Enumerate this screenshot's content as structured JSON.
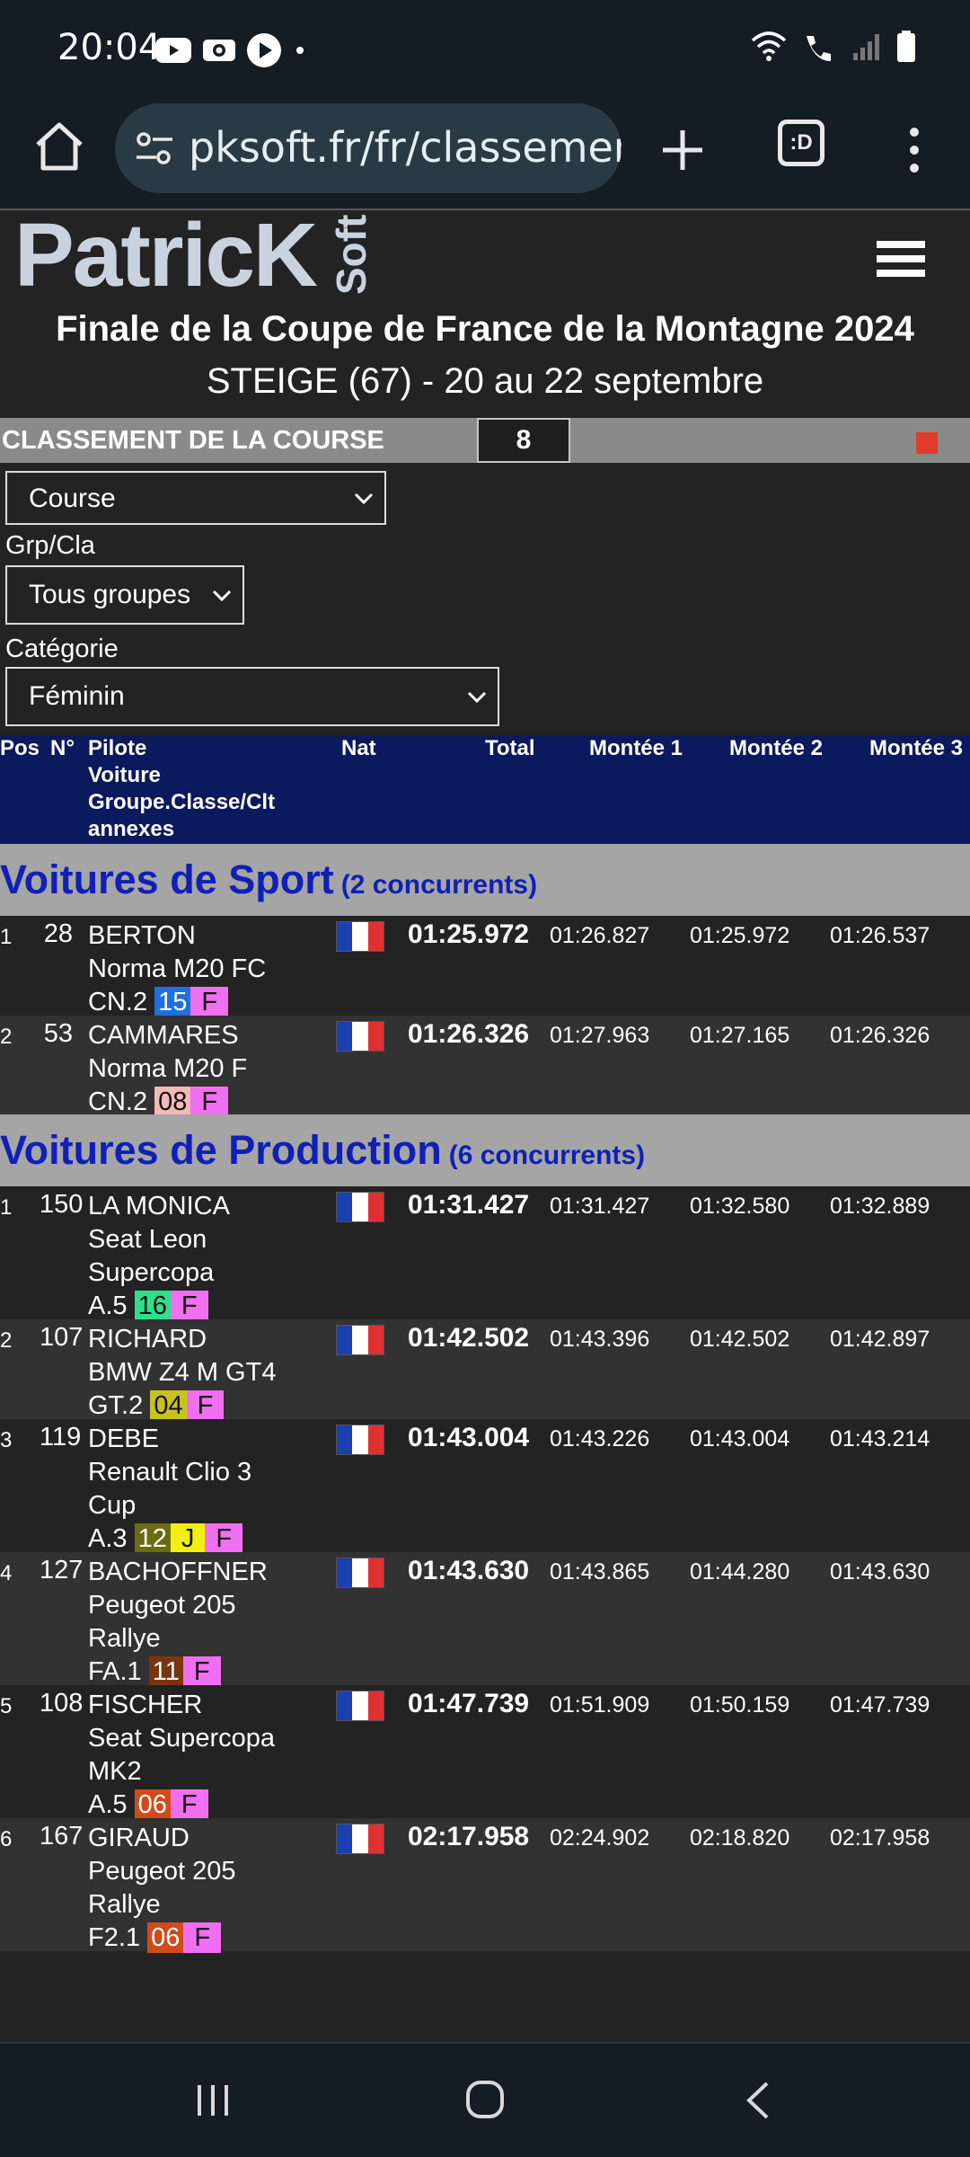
{
  "status": {
    "time": "20:04"
  },
  "browser": {
    "url": "pksoft.fr/fr/classement",
    "tab_count": ":D"
  },
  "site": {
    "logo_main": "PatricK",
    "logo_soft": "Soft",
    "event_title": "Finale de la Coupe de France de la Montagne 2024",
    "event_subtitle": "STEIGE (67) - 20 au 22 septembre"
  },
  "classement": {
    "label": "CLASSEMENT DE LA COURSE",
    "number": "8"
  },
  "filters": {
    "course_value": "Course",
    "grp_label": "Grp/Cla",
    "grp_value": "Tous groupes",
    "cat_label": "Catégorie",
    "cat_value": "Féminin"
  },
  "table_header": {
    "pos": "Pos",
    "num": "N°",
    "pilote_lines": [
      "Pilote",
      "Voiture",
      "Groupe.Classe/Clt",
      "annexes"
    ],
    "nat": "Nat",
    "total": "Total",
    "m1": "Montée 1",
    "m2": "Montée 2",
    "m3": "Montée 3"
  },
  "groups": [
    {
      "title": "Voitures de Sport",
      "count": "(2 concurrents)",
      "rows": [
        {
          "pos": "1",
          "num": "28",
          "pilote": "BERTON",
          "car": [
            "Norma M20 FC"
          ],
          "cls": "CN.2",
          "badges": [
            {
              "t": "15",
              "bg": "#1f6fe0",
              "fg": "#ffffff"
            },
            {
              "t": "F",
              "bg": "#f06ff0",
              "fg": "#111111"
            }
          ],
          "total": "01:25.972",
          "m1": "01:26.827",
          "m2": "01:25.972",
          "m3": "01:26.537"
        },
        {
          "pos": "2",
          "num": "53",
          "pilote": "CAMMARES",
          "car": [
            "Norma M20 F"
          ],
          "cls": "CN.2",
          "badges": [
            {
              "t": "08",
              "bg": "#f4b8b8",
              "fg": "#111111"
            },
            {
              "t": "F",
              "bg": "#f06ff0",
              "fg": "#111111"
            }
          ],
          "total": "01:26.326",
          "m1": "01:27.963",
          "m2": "01:27.165",
          "m3": "01:26.326"
        }
      ]
    },
    {
      "title": "Voitures de Production",
      "count": "(6 concurrents)",
      "rows": [
        {
          "pos": "1",
          "num": "150",
          "pilote": "LA MONICA",
          "car": [
            "Seat Leon",
            "Supercopa"
          ],
          "cls": "A.5",
          "badges": [
            {
              "t": "16",
              "bg": "#2ee08a",
              "fg": "#111111"
            },
            {
              "t": "F",
              "bg": "#f06ff0",
              "fg": "#111111"
            }
          ],
          "total": "01:31.427",
          "m1": "01:31.427",
          "m2": "01:32.580",
          "m3": "01:32.889"
        },
        {
          "pos": "2",
          "num": "107",
          "pilote": "RICHARD",
          "car": [
            "BMW Z4 M GT4"
          ],
          "cls": "GT.2",
          "badges": [
            {
              "t": "04",
              "bg": "#c8c21c",
              "fg": "#111111"
            },
            {
              "t": "F",
              "bg": "#f06ff0",
              "fg": "#111111"
            }
          ],
          "total": "01:42.502",
          "m1": "01:43.396",
          "m2": "01:42.502",
          "m3": "01:42.897"
        },
        {
          "pos": "3",
          "num": "119",
          "pilote": "DEBE",
          "car": [
            "Renault Clio 3",
            "Cup"
          ],
          "cls": "A.3",
          "badges": [
            {
              "t": "12",
              "bg": "#6b6b14",
              "fg": "#ffffff"
            },
            {
              "t": "J",
              "bg": "#f2ee10",
              "fg": "#111111"
            },
            {
              "t": "F",
              "bg": "#f06ff0",
              "fg": "#111111"
            }
          ],
          "total": "01:43.004",
          "m1": "01:43.226",
          "m2": "01:43.004",
          "m3": "01:43.214"
        },
        {
          "pos": "4",
          "num": "127",
          "pilote": "BACHOFFNER",
          "car": [
            "Peugeot 205",
            "Rallye"
          ],
          "cls": "FA.1",
          "badges": [
            {
              "t": "11",
              "bg": "#7a3410",
              "fg": "#ffffff"
            },
            {
              "t": "F",
              "bg": "#f06ff0",
              "fg": "#111111"
            }
          ],
          "total": "01:43.630",
          "m1": "01:43.865",
          "m2": "01:44.280",
          "m3": "01:43.630"
        },
        {
          "pos": "5",
          "num": "108",
          "pilote": "FISCHER",
          "car": [
            "Seat Supercopa",
            "MK2"
          ],
          "cls": "A.5",
          "badges": [
            {
              "t": "06",
              "bg": "#d24a1c",
              "fg": "#ffffff"
            },
            {
              "t": "F",
              "bg": "#f06ff0",
              "fg": "#111111"
            }
          ],
          "total": "01:47.739",
          "m1": "01:51.909",
          "m2": "01:50.159",
          "m3": "01:47.739"
        },
        {
          "pos": "6",
          "num": "167",
          "pilote": "GIRAUD",
          "car": [
            "Peugeot 205",
            "Rallye"
          ],
          "cls": "F2.1",
          "badges": [
            {
              "t": "06",
              "bg": "#d24a1c",
              "fg": "#ffffff"
            },
            {
              "t": "F",
              "bg": "#f06ff0",
              "fg": "#111111"
            }
          ],
          "total": "02:17.958",
          "m1": "02:24.902",
          "m2": "02:18.820",
          "m3": "02:17.958"
        }
      ]
    }
  ],
  "colors": {
    "group_title": "#1020b6",
    "table_header_bg": "#0b1a5c",
    "flag": [
      "#1a3fb0",
      "#ffffff",
      "#e03030"
    ]
  }
}
